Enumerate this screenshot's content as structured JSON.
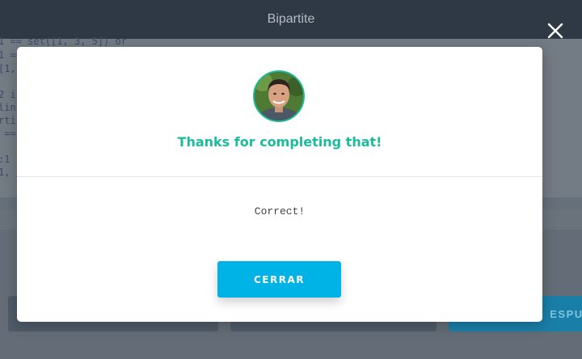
{
  "app": {
    "title": "Bipartite",
    "code_lines": [
      "1 == set([1, 3, 5]) or",
      "1 ==",
      "[1,",
      "",
      "2 i",
      "link",
      "rti",
      " ==",
      "",
      ":1",
      "1,"
    ],
    "bg_buttons": {
      "submit_partial": "ESPUES"
    }
  },
  "modal": {
    "heading": "Thanks for completing that!",
    "message": "Correct!",
    "close_button": "CERRAR"
  },
  "colors": {
    "accent_teal": "#1abc9c",
    "button_blue": "#00b3e6",
    "topbar": "#2f3946"
  },
  "icons": {
    "close": "close-icon",
    "avatar": "avatar"
  }
}
